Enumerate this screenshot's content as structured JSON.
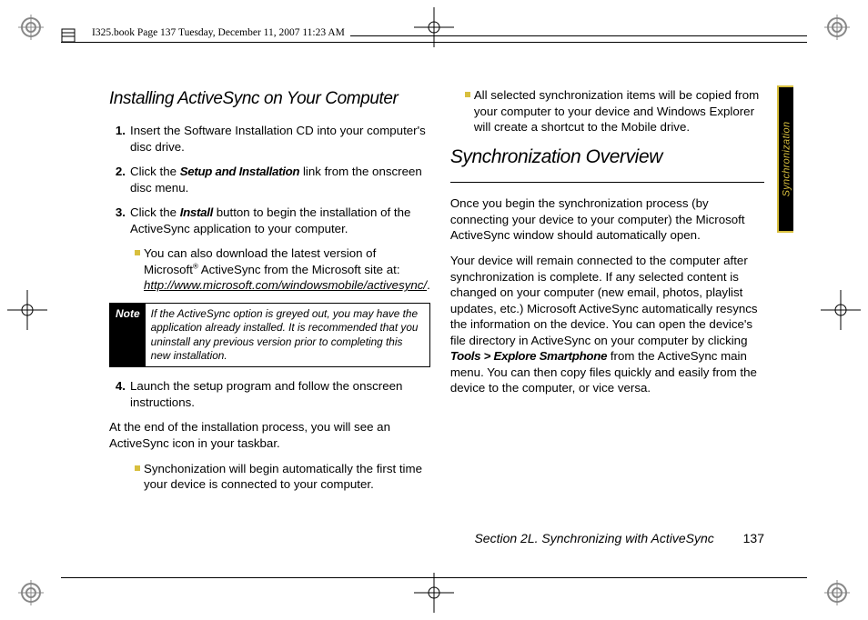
{
  "draft_header": "I325.book  Page 137  Tuesday, December 11, 2007  11:23 AM",
  "side_tab": "Synchronization",
  "left": {
    "heading": "Installing ActiveSync on Your Computer",
    "step1_num": "1.",
    "step1": "Insert the Software Installation CD into your computer's disc drive.",
    "step2_num": "2.",
    "step2_a": "Click the ",
    "step2_b": "Setup and Installation",
    "step2_c": " link from the onscreen disc menu.",
    "step3_num": "3.",
    "step3_a": "Click the ",
    "step3_b": "Install",
    "step3_c": " button to begin the installation of the ActiveSync application to your computer.",
    "sub1_a": "You can also download the latest version of Microsoft",
    "sub1_reg": "®",
    "sub1_b": " ActiveSync from the Microsoft site at: ",
    "sub1_url": "http://www.microsoft.com/windowsmobile/activesync/",
    "sub1_dot": ".",
    "note_label": "Note",
    "note_text": "If the ActiveSync option is greyed out, you may have the application already installed. It is recommended that you uninstall any previous version prior to completing this new installation.",
    "step4_num": "4.",
    "step4": "Launch the setup program and follow the onscreen instructions.",
    "para_end": "At the end of the installation process, you will see an ActiveSync icon in your taskbar.",
    "sub2": "Synchonization will begin automatically the first time your device is connected to your computer."
  },
  "right": {
    "sub1": "All selected synchronization items will be copied from your computer to your device and Windows Explorer will create a shortcut to the Mobile drive.",
    "heading": "Synchronization Overview",
    "p1": "Once you begin the synchronization process (by connecting your device to your computer) the Microsoft ActiveSync window should automatically open.",
    "p2_a": "Your device will remain connected to the computer after synchronization is complete. If any selected content is changed on your computer (new email, photos, playlist updates, etc.) Microsoft ActiveSync automatically resyncs the information on the device. You can open the device's file directory in ActiveSync on your computer by clicking ",
    "p2_b": "Tools > Explore Smartphone",
    "p2_c": " from the ActiveSync main menu. You can then copy files quickly and easily from the device to the computer, or vice versa."
  },
  "footer": {
    "section": "Section 2L. Synchronizing with ActiveSync",
    "page": "137"
  }
}
